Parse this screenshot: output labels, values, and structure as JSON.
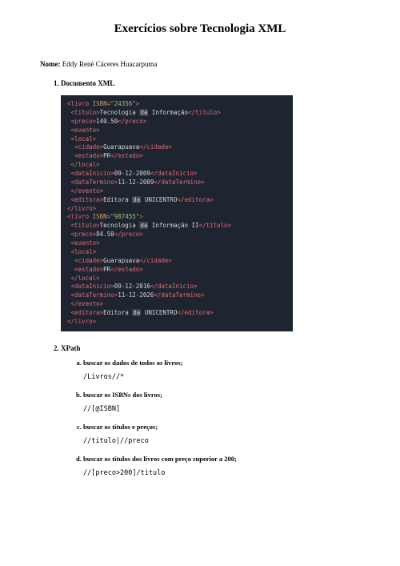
{
  "title": "Exercícios sobre Tecnologia XML",
  "nameLabel": "Nome:",
  "nameValue": "Eddy René Cáceres Huacarpuma",
  "section1": {
    "heading": "Documento XML"
  },
  "section2": {
    "heading": "XPath",
    "items": [
      {
        "q": "buscar os dados de todos os livros;",
        "a": "/Livros//*"
      },
      {
        "q": "buscar os ISBNs dos livros;",
        "a": "//[@ISBN]"
      },
      {
        "q": "buscar os títulos e preços;",
        "a": "//titulo|//preco"
      },
      {
        "q": "buscar os títulos dos livros com preço superior a 200;",
        "a": "//[preco>200]/titulo"
      }
    ]
  },
  "chart_data": {
    "type": "table",
    "title": "Documento XML - livros",
    "records": [
      {
        "ISBN": "24356",
        "titulo": "Tecnologia da Informação",
        "preco": 140.5,
        "evento": {
          "local": {
            "cidade": "Guarapuava",
            "estado": "PR"
          },
          "dataInicio": "09-12-2009",
          "dataTermino": "11-12-2009"
        },
        "editora": "Editora da UNICENTRO"
      },
      {
        "ISBN": "987455",
        "titulo": "Tecnologia da Informação II",
        "preco": 84.5,
        "evento": {
          "local": {
            "cidade": "Guarapuava",
            "estado": "PR"
          },
          "dataInicio": "09-12-2016",
          "dataTermino": "11-12-2026"
        },
        "editora": "Editora da UNICENTRO"
      }
    ]
  }
}
